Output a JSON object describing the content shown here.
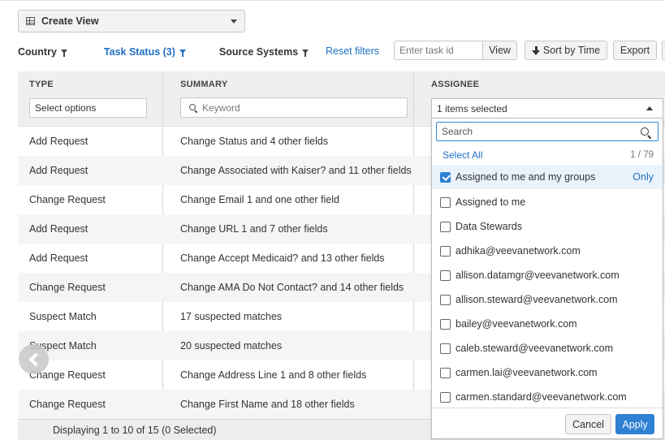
{
  "view_selector": {
    "label": "Create View",
    "icon": "grid-icon"
  },
  "filters": [
    {
      "label": "Country",
      "active": false
    },
    {
      "label": "Task Status (3)",
      "active": true
    },
    {
      "label": "Source Systems",
      "active": false
    }
  ],
  "reset_filters": "Reset filters",
  "task_input": {
    "placeholder": "Enter task id",
    "value": ""
  },
  "buttons": {
    "view": "View",
    "sort": "Sort by Time",
    "export": "Export"
  },
  "table": {
    "columns": [
      "TYPE",
      "SUMMARY",
      "ASSIGNEE"
    ],
    "type_filter_placeholder": "Select options",
    "summary_filter_placeholder": "Keyword",
    "assignee_filter_value": "1 items selected",
    "rows": [
      {
        "type": "Add Request",
        "summary": "Change Status and 4 other fields"
      },
      {
        "type": "Add Request",
        "summary": "Change Associated with Kaiser? and 11 other fields"
      },
      {
        "type": "Change Request",
        "summary": "Change Email 1 and one other field"
      },
      {
        "type": "Add Request",
        "summary": "Change URL 1 and 7 other fields"
      },
      {
        "type": "Add Request",
        "summary": "Change Accept Medicaid? and 13 other fields"
      },
      {
        "type": "Change Request",
        "summary": "Change AMA Do Not Contact? and 14 other fields"
      },
      {
        "type": "Suspect Match",
        "summary": "17 suspected matches"
      },
      {
        "type": "Suspect Match",
        "summary": "20 suspected matches"
      },
      {
        "type": "Change Request",
        "summary": "Change Address Line 1 and 8 other fields"
      },
      {
        "type": "Change Request",
        "summary": "Change First Name and 18 other fields"
      }
    ],
    "footer": "Displaying 1 to 10 of 15 (0 Selected)"
  },
  "assignee_dropdown": {
    "search_placeholder": "Search",
    "select_all": "Select All",
    "count": "1 / 79",
    "only_label": "Only",
    "options": [
      {
        "label": "Assigned to me and my groups",
        "checked": true
      },
      {
        "label": "Assigned to me",
        "checked": false
      },
      {
        "label": "Data Stewards",
        "checked": false
      },
      {
        "label": "adhika@veevanetwork.com",
        "checked": false
      },
      {
        "label": "allison.datamgr@veevanetwork.com",
        "checked": false
      },
      {
        "label": "allison.steward@veevanetwork.com",
        "checked": false
      },
      {
        "label": "bailey@veevanetwork.com",
        "checked": false
      },
      {
        "label": "caleb.steward@veevanetwork.com",
        "checked": false
      },
      {
        "label": "carmen.lai@veevanetwork.com",
        "checked": false
      },
      {
        "label": "carmen.standard@veevanetwork.com",
        "checked": false
      }
    ],
    "cancel": "Cancel",
    "apply": "Apply"
  },
  "colors": {
    "link": "#1f6fc4",
    "primary": "#2f80d3",
    "header_bg": "#efefef"
  }
}
